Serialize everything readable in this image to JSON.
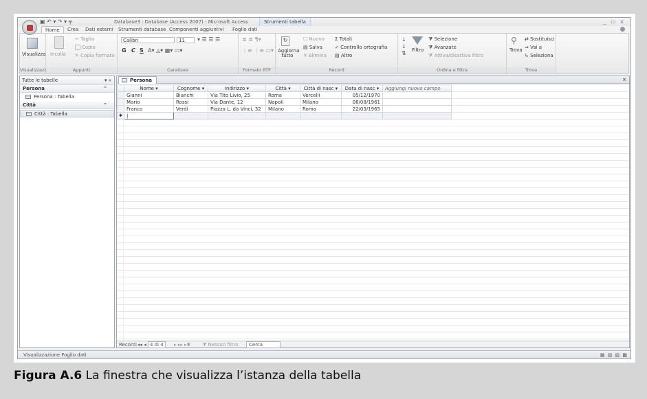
{
  "window": {
    "title": "Database3 : Database (Access 2007) - Microsoft Access",
    "context_title": "Strumenti tabella",
    "controls": "_ ▭ x",
    "qat": "▣ ↶ ▾ ↷ ▾ ╤"
  },
  "ribbon_tabs": [
    "Home",
    "Crea",
    "Dati esterni",
    "Strumenti database",
    "Componenti aggiuntivi",
    "Foglio dati"
  ],
  "groups": {
    "visualizzazioni": {
      "name": "Visualizzazioni",
      "view_label": "Visualizza"
    },
    "appunti": {
      "name": "Appunti",
      "paste": "Incolla",
      "cut": "Taglia",
      "copy": "Copia",
      "format_painter": "Copia formato"
    },
    "carattere": {
      "name": "Carattere",
      "font": "Calibri",
      "size": "11",
      "bold": "G",
      "italic": "C",
      "underline": "S"
    },
    "rtf": {
      "name": "Formato RTF"
    },
    "record": {
      "name": "Record",
      "refresh": "Aggiorna tutto",
      "new": "Nuovo",
      "save": "Salva",
      "delete": "Elimina",
      "totals": "Totali",
      "spelling": "Controllo ortografia",
      "more": "Altro"
    },
    "ordina": {
      "name": "Ordina e filtra",
      "filter": "Filtro",
      "selection": "Selezione",
      "advanced": "Avanzate",
      "toggle": "Attiva/disattiva filtro"
    },
    "trova": {
      "name": "Trova",
      "find": "Trova",
      "replace": "Sostituisci",
      "goto": "Vai a",
      "select": "Seleziona"
    }
  },
  "nav_pane": {
    "header": "Tutte le tabelle",
    "sections": [
      {
        "name": "Persona",
        "item": "Persona : Tabella"
      },
      {
        "name": "Città",
        "item": "Città : Tabella"
      }
    ]
  },
  "document_tab": "Persona",
  "table": {
    "headers": [
      "Nome",
      "Cognome",
      "Indirizzo",
      "Città",
      "Città di nasc",
      "Data di nasc",
      "Aggiungi nuovo campo"
    ],
    "rows": [
      [
        "Gianni",
        "Bianchi",
        "Via Tito Livio, 25",
        "Roma",
        "Vercelli",
        "05/12/1970"
      ],
      [
        "Mario",
        "Rossi",
        "Via Dante, 12",
        "Napoli",
        "Milano",
        "08/08/1961"
      ],
      [
        "Franco",
        "Verdi",
        "Piazza L. da Vinci, 32",
        "Milano",
        "Roma",
        "22/03/1965"
      ]
    ]
  },
  "record_nav": {
    "label": "Record:",
    "position": "4 di 4",
    "filter": "Nessun filtro",
    "search": "Cerca"
  },
  "status": "Visualizzazione Foglio dati",
  "caption": {
    "label": "Figura A.6",
    "text": " La finestra che visualizza l’istanza della tabella"
  }
}
